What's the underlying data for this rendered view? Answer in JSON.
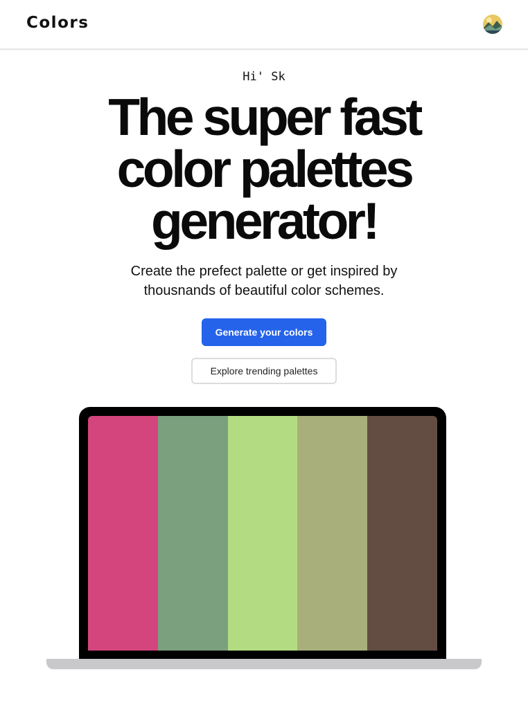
{
  "navbar": {
    "brand": "Colors",
    "avatar_icon": "user-avatar"
  },
  "hero": {
    "greeting": "Hi' Sk",
    "headline_lines": [
      "The super fast",
      "color palettes",
      "generator!"
    ],
    "subtitle_lines": [
      "Create the prefect palette or get inspired by",
      "thousnands of beautiful color schemes."
    ],
    "primary_button": "Generate your colors",
    "secondary_button": "Explore trending palettes"
  },
  "palette": {
    "colors": [
      "#d3457c",
      "#7aa07e",
      "#b3dc82",
      "#a9af7a",
      "#634d42"
    ]
  },
  "theme": {
    "accent": "#2563eb"
  }
}
